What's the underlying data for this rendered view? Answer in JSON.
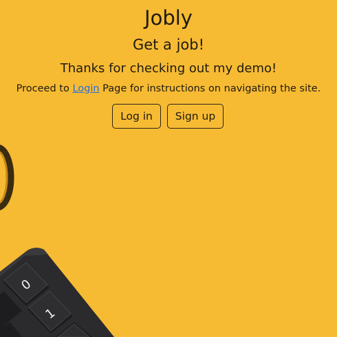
{
  "hero": {
    "brand": "Jobly",
    "tagline": "Get a job!",
    "thanks": "Thanks for checking out my demo!",
    "instructions_before": "Proceed to ",
    "login_link": "Login",
    "instructions_after": " Page for instructions on navigating the site."
  },
  "actions": {
    "login_label": "Log in",
    "signup_label": "Sign up"
  },
  "background": {
    "color": "#f7bb33",
    "calculator_keys": [
      "0",
      "1"
    ]
  }
}
